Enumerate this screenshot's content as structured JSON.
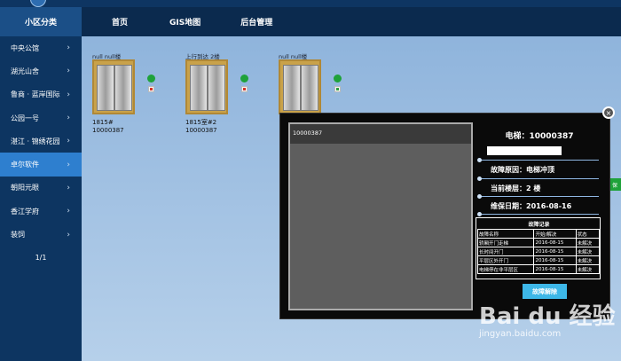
{
  "header": {
    "side_title": "小区分类",
    "nav": [
      "首页",
      "GIS地图",
      "后台管理"
    ]
  },
  "sidebar": {
    "items": [
      {
        "label": "中央公馆"
      },
      {
        "label": "湖光山舍"
      },
      {
        "label": "鲁商 · 蓝岸国际"
      },
      {
        "label": "公园一号"
      },
      {
        "label": "湛江 · 锦绣花园"
      },
      {
        "label": "卓尔软件"
      },
      {
        "label": "朝阳元眼"
      },
      {
        "label": "香江学府"
      },
      {
        "label": "装饲"
      }
    ],
    "pager": "1/1"
  },
  "elevators": [
    {
      "label": "null null楼",
      "info1": "1815#",
      "info2": "10000387",
      "side_icon": "red"
    },
    {
      "label": "上行到达 2楼",
      "info1": "1815室#2",
      "info2": "10000387",
      "side_icon": "red"
    },
    {
      "label": "null null楼",
      "info1": "",
      "info2": "",
      "side_icon": "green"
    }
  ],
  "right_tab": "保",
  "modal": {
    "close": "×",
    "video_title": "10000387",
    "elevator_title": "电梯：10000387",
    "fault_reason": "故障原因：电梯冲顶",
    "current_floor": "当前楼层：2 楼",
    "maintenance_date": "维保日期：2016-08-16",
    "records": {
      "title": "故障记录",
      "headers": [
        "故障名称",
        "开始/解决",
        "状态"
      ],
      "rows": [
        [
          "轿厢开门走梯",
          "2016-08-15",
          "未解决"
        ],
        [
          "长时间开门",
          "2016-08-15",
          "未解决"
        ],
        [
          "平层区外开门",
          "2016-08-15",
          "未解决"
        ],
        [
          "电梯停在非平层区",
          "2016-08-15",
          "未解决"
        ]
      ]
    },
    "release_button": "故障解除"
  },
  "watermark": {
    "main": "Bai du 经验",
    "sub": "jingyan.baidu.com"
  }
}
